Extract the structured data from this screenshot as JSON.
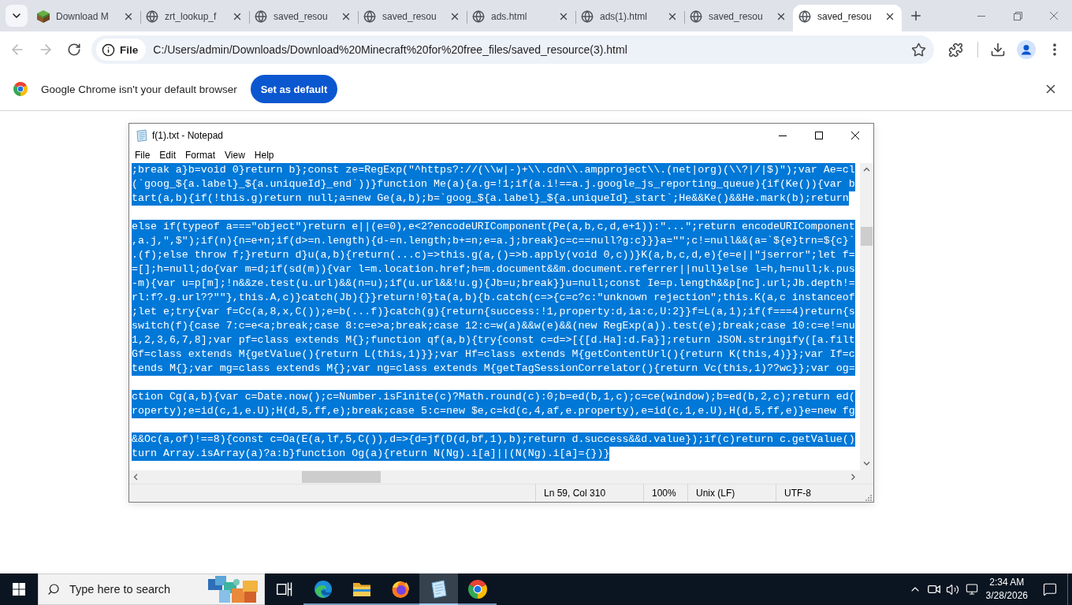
{
  "browser": {
    "tabs": [
      {
        "title": "Download M",
        "kind": "block",
        "selected": false
      },
      {
        "title": "zrt_lookup_f",
        "kind": "globe",
        "selected": false
      },
      {
        "title": "saved_resou",
        "kind": "globe",
        "selected": false
      },
      {
        "title": "saved_resou",
        "kind": "globe",
        "selected": false
      },
      {
        "title": "ads.html",
        "kind": "globe",
        "selected": false
      },
      {
        "title": "ads(1).html",
        "kind": "globe",
        "selected": false
      },
      {
        "title": "saved_resou",
        "kind": "globe",
        "selected": false
      },
      {
        "title": "saved_resou",
        "kind": "globe",
        "selected": true
      }
    ],
    "nav": {
      "back_disabled": true,
      "forward_disabled": true
    },
    "address": {
      "chip": "File",
      "url": "C:/Users/admin/Downloads/Download%20Minecraft%20for%20free_files/saved_resource(3).html"
    },
    "infobar": {
      "message": "Google Chrome isn't your default browser",
      "button": "Set as default"
    }
  },
  "notepad": {
    "title": "f(1).txt - Notepad",
    "menu": [
      "File",
      "Edit",
      "Format",
      "View",
      "Help"
    ],
    "blocks": [
      {
        "lines": [
          {
            "text": ";break a}b=void 0}return b};const ze=RegExp(\"^https?://(\\\\w|-)+\\\\.cdn\\\\.ampproject\\\\.(net|org)(\\\\?|/|$)\");var Ae=cl",
            "selected": true
          },
          {
            "text": "(`goog_${a.label}_${a.uniqueId}_end`))}function Me(a){a.g=!1;if(a.i!==a.j.google_js_reporting_queue){if(Ke()){var b",
            "selected": true
          },
          {
            "text": "tart(a,b){if(!this.g)return null;a=new Ge(a,b);b=`goog_${a.label}_${a.uniqueId}_start`;He&&Ke()&&He.mark(b);return",
            "selected": true
          }
        ]
      },
      {
        "lines": [
          {
            "text": "else if(typeof a===\"object\")return e||(e=0),e<2?encodeURIComponent(Pe(a,b,c,d,e+1)):\"...\";return encodeURIComponent",
            "selected": true
          },
          {
            "text": ",a.j,\",$\");if(n){n=e+n;if(d>=n.length){d-=n.length;b+=n;e=a.j;break}c=c==null?g:c}}}a=\"\";c!=null&&(a=`${e}trn=${c}`",
            "selected": true
          },
          {
            "text": ".(f);else throw f;}return d}u(a,b){return(...c)=>this.g(a,()=>b.apply(void 0,c))}K(a,b,c,d,e){e=e||\"jserror\";let f=",
            "selected": true
          },
          {
            "text": "=[];h=null;do{var m=d;if(sd(m)){var l=m.location.href;h=m.document&&m.document.referrer||null}else l=h,h=null;k.pus",
            "selected": true
          },
          {
            "text": "-m){var u=p[m];!n&&ze.test(u.url)&&(n=u);if(u.url&&!u.g){Jb=u;break}}u=null;const Ie=p.length&&p[nc].url;Jb.depth!=",
            "selected": true
          },
          {
            "text": "rl:f?.g.url??\"\"},this.A,c)}catch(Jb){}}return!0}ta(a,b){b.catch(c=>{c=c?c:\"unknown rejection\";this.K(a,c instanceof",
            "selected": true
          },
          {
            "text": ";let e;try{var f=Cc(a,8,x,C());e=b(...f)}catch(g){return{success:!1,property:d,ia:c,U:2}}f=L(a,1);if(f===4)return{s",
            "selected": true
          },
          {
            "text": "switch(f){case 7:c=e<a;break;case 8:c=e>a;break;case 12:c=w(a)&&w(e)&&(new RegExp(a)).test(e);break;case 10:c=e!=nu",
            "selected": true
          },
          {
            "text": "1,2,3,6,7,8];var pf=class extends M{};function qf(a,b){try{const c=d=>[{[d.Ha]:d.Fa}];return JSON.stringify([a.filt",
            "selected": true
          },
          {
            "text": "Gf=class extends M{getValue(){return L(this,1)}};var Hf=class extends M{getContentUrl(){return K(this,4)}};var If=c",
            "selected": true
          },
          {
            "text": "tends M{};var mg=class extends M{};var ng=class extends M{getTagSessionCorrelator(){return Vc(this,1)??wc}};var og=",
            "selected": true
          }
        ]
      },
      {
        "lines": [
          {
            "text": "ction Cg(a,b){var c=Date.now();c=Number.isFinite(c)?Math.round(c):0;b=ed(b,1,c);c=ce(window);b=ed(b,2,c);return ed(",
            "selected": true
          },
          {
            "text": "roperty);e=id(c,1,e.U);H(d,5,ff,e);break;case 5:c=new $e,c=kd(c,4,af,e.property),e=id(c,1,e.U),H(d,5,ff,e)}e=new fg",
            "selected": true
          }
        ]
      },
      {
        "lines": [
          {
            "text": "&&Oc(a,of)!==8){const c=Oa(E(a,lf,5,C()),d=>{d=jf(D(d,bf,1),b);return d.success&&d.value});if(c)return c.getValue()",
            "selected": true
          },
          {
            "text": "turn Array.isArray(a)?a:b}function Og(a){return N(Ng).i[a]||(N(Ng).i[a]={})}",
            "selected": true
          }
        ]
      }
    ],
    "status": [
      "Ln 59, Col 310",
      "100%",
      "Unix (LF)",
      "UTF-8"
    ]
  },
  "taskbar": {
    "search": {
      "placeholder": "Type here to search"
    },
    "apps": [
      {
        "kind": "edge",
        "running": true,
        "selected": false
      },
      {
        "kind": "explorer",
        "running": true,
        "selected": false
      },
      {
        "kind": "firefox",
        "running": true,
        "selected": false
      },
      {
        "kind": "notepad",
        "running": true,
        "selected": true
      },
      {
        "kind": "chrome",
        "running": true,
        "selected": false
      }
    ],
    "time": "2:34 AM",
    "date": "3/28/2026"
  }
}
